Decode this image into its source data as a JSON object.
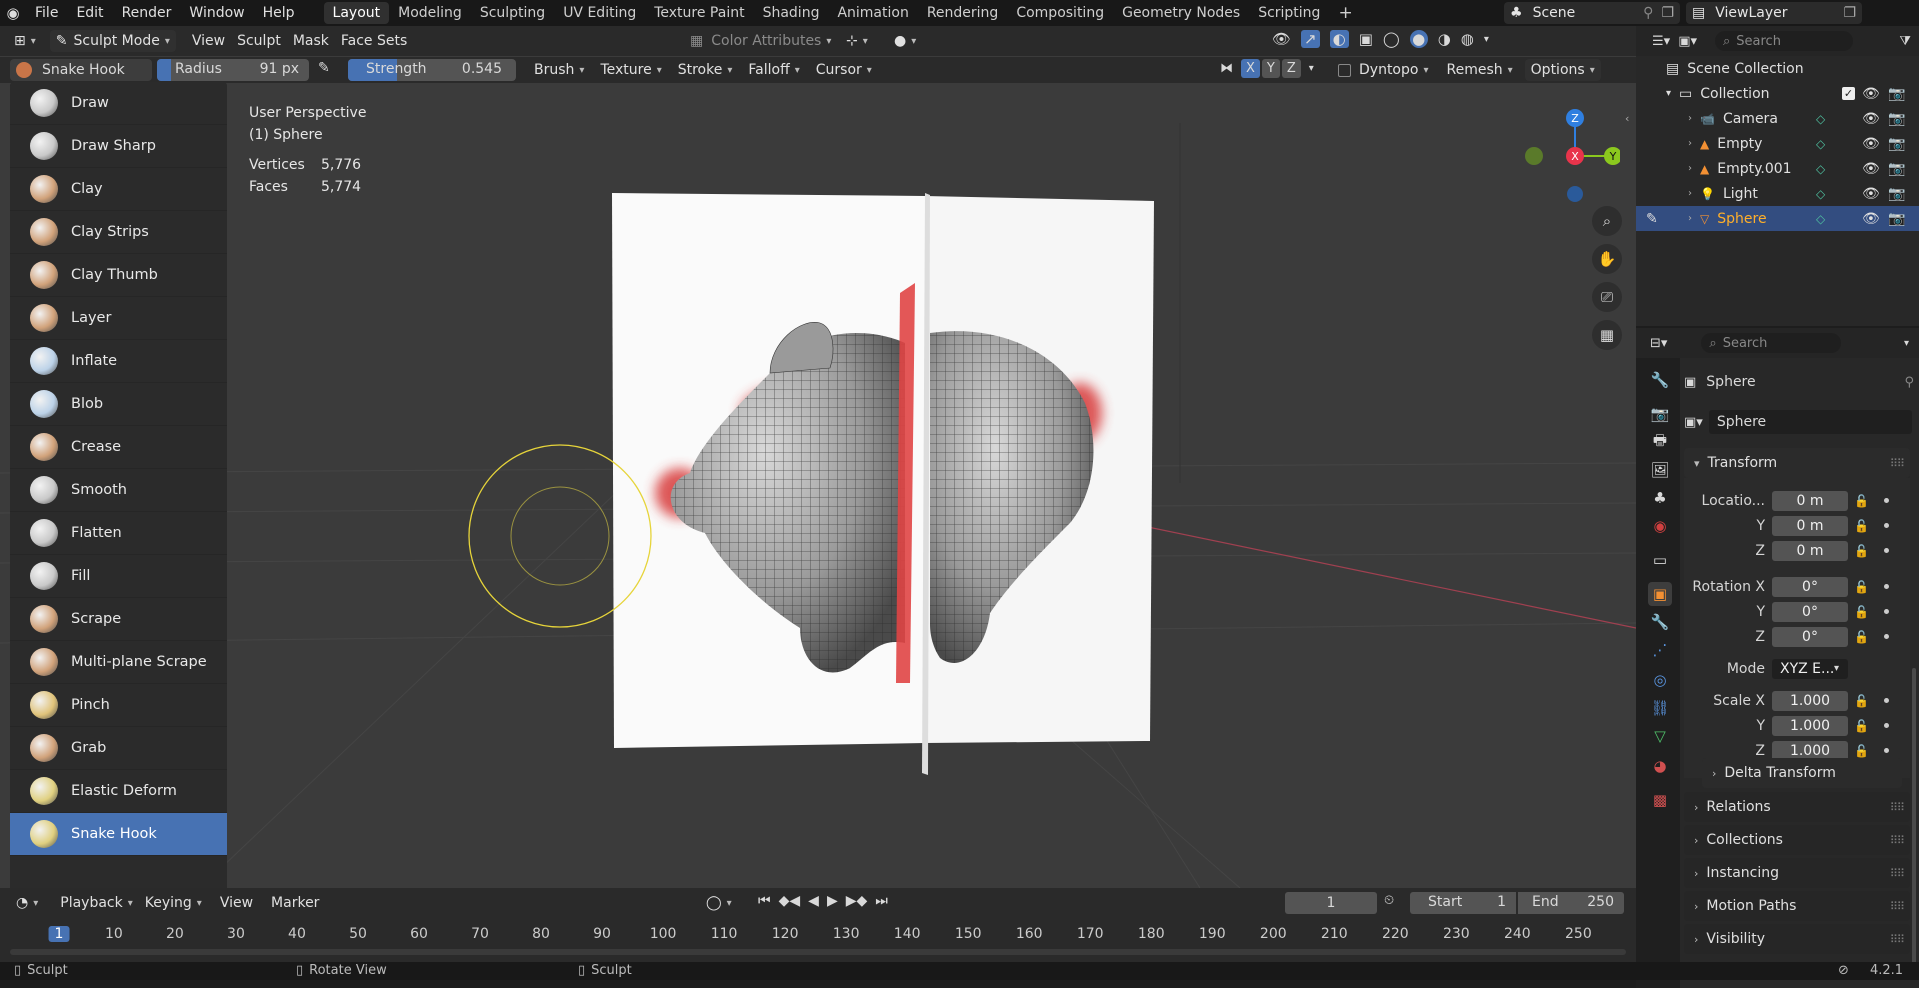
{
  "topbar": {
    "menus": [
      "File",
      "Edit",
      "Render",
      "Window",
      "Help"
    ],
    "workspaces": [
      "Layout",
      "Modeling",
      "Sculpting",
      "UV Editing",
      "Texture Paint",
      "Shading",
      "Animation",
      "Rendering",
      "Compositing",
      "Geometry Nodes",
      "Scripting"
    ],
    "active_workspace": "Layout",
    "add_tab": "+",
    "scene": "Scene",
    "view_layer": "ViewLayer"
  },
  "viewport_header": {
    "mode": "Sculpt Mode",
    "menus": [
      "View",
      "Sculpt",
      "Mask",
      "Face Sets"
    ],
    "color_attributes": "Color Attributes"
  },
  "tool_settings": {
    "brush": "Snake Hook",
    "radius_label": "Radius",
    "radius_value": "91 px",
    "strength_label": "Strength",
    "strength_value": "0.545",
    "strength_fraction": 0.545,
    "dropdowns": [
      "Brush",
      "Texture",
      "Stroke",
      "Falloff",
      "Cursor"
    ],
    "axes": [
      "X",
      "Y",
      "Z"
    ],
    "dyntopo": "Dyntopo",
    "remesh": "Remesh",
    "options": "Options"
  },
  "toolbar": {
    "tools": [
      "Draw",
      "Draw Sharp",
      "Clay",
      "Clay Strips",
      "Clay Thumb",
      "Layer",
      "Inflate",
      "Blob",
      "Crease",
      "Smooth",
      "Flatten",
      "Fill",
      "Scrape",
      "Multi-plane Scrape",
      "Pinch",
      "Grab",
      "Elastic Deform",
      "Snake Hook"
    ],
    "active": "Snake Hook"
  },
  "overlay_info": {
    "perspective": "User Perspective",
    "object": "(1) Sphere",
    "vertices_label": "Vertices",
    "vertices": "5,776",
    "faces_label": "Faces",
    "faces": "5,774"
  },
  "gizmo": {
    "z": "Z",
    "x": "X",
    "y": "Y"
  },
  "outliner": {
    "search_placeholder": "Search",
    "scene_collection": "Scene Collection",
    "collection": "Collection",
    "items": [
      "Camera",
      "Empty",
      "Empty.001",
      "Light",
      "Sphere"
    ],
    "selected": "Sphere"
  },
  "properties": {
    "search_placeholder": "Search",
    "object_name": "Sphere",
    "datablock": "Sphere",
    "transform_label": "Transform",
    "location_label": "Locatio...",
    "rotation_label": "Rotation X",
    "scale_label": "Scale X",
    "y_label": "Y",
    "z_label": "Z",
    "location": [
      "0 m",
      "0 m",
      "0 m"
    ],
    "rotation": [
      "0°",
      "0°",
      "0°"
    ],
    "mode_label": "Mode",
    "mode_value": "XYZ E...",
    "scale": [
      "1.000",
      "1.000",
      "1.000"
    ],
    "delta_transform": "Delta Transform",
    "sections": [
      "Relations",
      "Collections",
      "Instancing",
      "Motion Paths",
      "Visibility"
    ]
  },
  "timeline": {
    "menus": [
      "Playback",
      "Keying",
      "View",
      "Marker"
    ],
    "current_frame": "1",
    "start_label": "Start",
    "start": "1",
    "end_label": "End",
    "end": "250",
    "ruler": [
      "1",
      "10",
      "20",
      "30",
      "40",
      "50",
      "60",
      "70",
      "80",
      "90",
      "100",
      "110",
      "120",
      "130",
      "140",
      "150",
      "160",
      "170",
      "180",
      "190",
      "200",
      "210",
      "220",
      "230",
      "240",
      "250"
    ]
  },
  "statusbar": {
    "items": [
      "Sculpt",
      "Rotate View",
      "Sculpt"
    ],
    "version": "4.2.1"
  },
  "colors": {
    "accent": "#4772b3",
    "selected_text": "#ffaf29",
    "axis_x": "#e8344b",
    "axis_y": "#8bc81e",
    "axis_z": "#2f7fe0",
    "brush_circle": "#e6d43a"
  }
}
